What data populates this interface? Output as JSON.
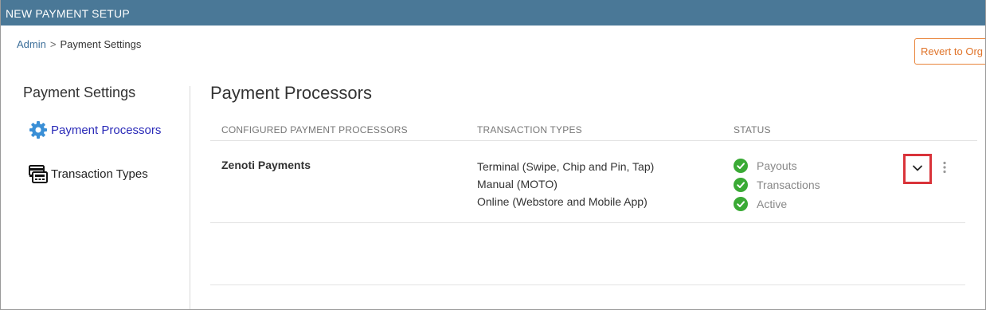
{
  "window": {
    "title": "NEW PAYMENT SETUP"
  },
  "breadcrumb": {
    "root": "Admin",
    "separator": ">",
    "current": "Payment Settings"
  },
  "header": {
    "revert_label": "Revert to Org Settings"
  },
  "sidebar": {
    "title": "Payment Settings",
    "items": [
      {
        "label": "Payment Processors",
        "icon": "gear-icon",
        "active": true
      },
      {
        "label": "Transaction Types",
        "icon": "card-terminal-icon",
        "active": false
      }
    ]
  },
  "main": {
    "title": "Payment Processors",
    "columns": [
      "CONFIGURED PAYMENT PROCESSORS",
      "TRANSACTION TYPES",
      "STATUS"
    ],
    "rows": [
      {
        "processor": "Zenoti Payments",
        "transaction_types": [
          "Terminal (Swipe, Chip and Pin, Tap)",
          "Manual (MOTO)",
          "Online (Webstore and Mobile App)"
        ],
        "statuses": [
          "Payouts",
          "Transactions",
          "Active"
        ]
      }
    ]
  },
  "colors": {
    "titlebar": "#4a7897",
    "active_link": "#2a2ab8",
    "check_green": "#3aaa35",
    "revert_orange": "#e0742a",
    "highlight_red": "#d9333a"
  }
}
